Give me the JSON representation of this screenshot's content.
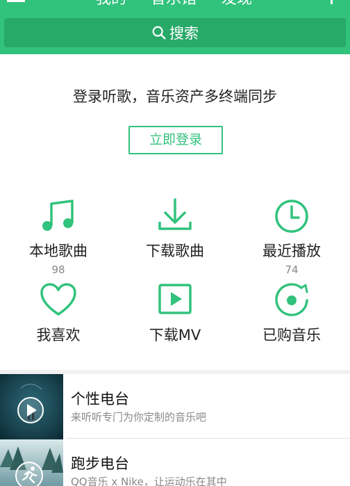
{
  "header": {
    "tabs": [
      "我的",
      "音乐馆",
      "发现"
    ],
    "search_label": "搜索",
    "menu_icon": "menu-icon",
    "add_icon": "plus-icon",
    "accent_color": "#31c27c"
  },
  "login": {
    "prompt": "登录听歌，音乐资产多终端同步",
    "button_label": "立即登录"
  },
  "features": [
    {
      "icon": "music-note-icon",
      "label": "本地歌曲",
      "count": "98"
    },
    {
      "icon": "download-icon",
      "label": "下载歌曲",
      "count": ""
    },
    {
      "icon": "clock-icon",
      "label": "最近播放",
      "count": "74"
    },
    {
      "icon": "heart-icon",
      "label": "我喜欢",
      "count": ""
    },
    {
      "icon": "mv-play-icon",
      "label": "下载MV",
      "count": ""
    },
    {
      "icon": "purchased-disc-icon",
      "label": "已购音乐",
      "count": ""
    }
  ],
  "radio": [
    {
      "title": "个性电台",
      "desc": "来听听专门为你定制的音乐吧",
      "icon": "play-icon"
    },
    {
      "title": "跑步电台",
      "desc": "QQ音乐 x Nike，让运动乐在其中",
      "icon": "runner-icon"
    }
  ]
}
